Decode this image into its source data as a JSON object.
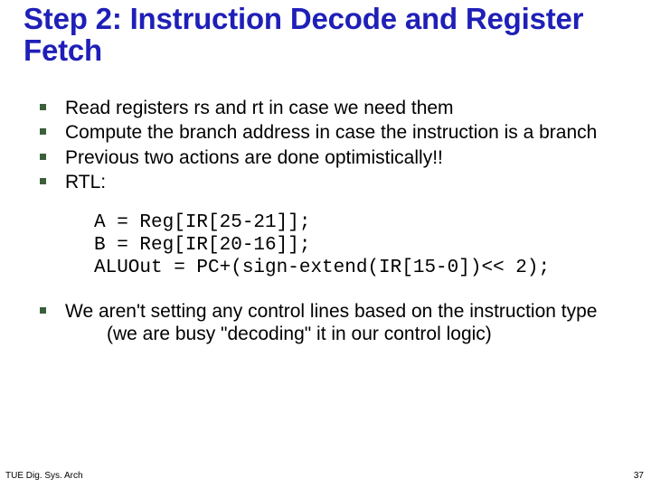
{
  "title": "Step 2:  Instruction Decode and Register Fetch",
  "bullets_a": [
    "Read registers rs and rt in case we need them",
    "Compute the branch address in case the instruction is a branch",
    "Previous two actions are done optimistically!!",
    "RTL:"
  ],
  "code": "A = Reg[IR[25-21]];\nB = Reg[IR[20-16]];\nALUOut = PC+(sign-extend(IR[15-0])<< 2);",
  "bullets_b_main": "We aren't setting any control lines based on the instruction type",
  "bullets_b_sub": "(we are busy \"decoding\" it in our control logic)",
  "footer_left": "TUE Dig. Sys. Arch",
  "footer_right": "37"
}
